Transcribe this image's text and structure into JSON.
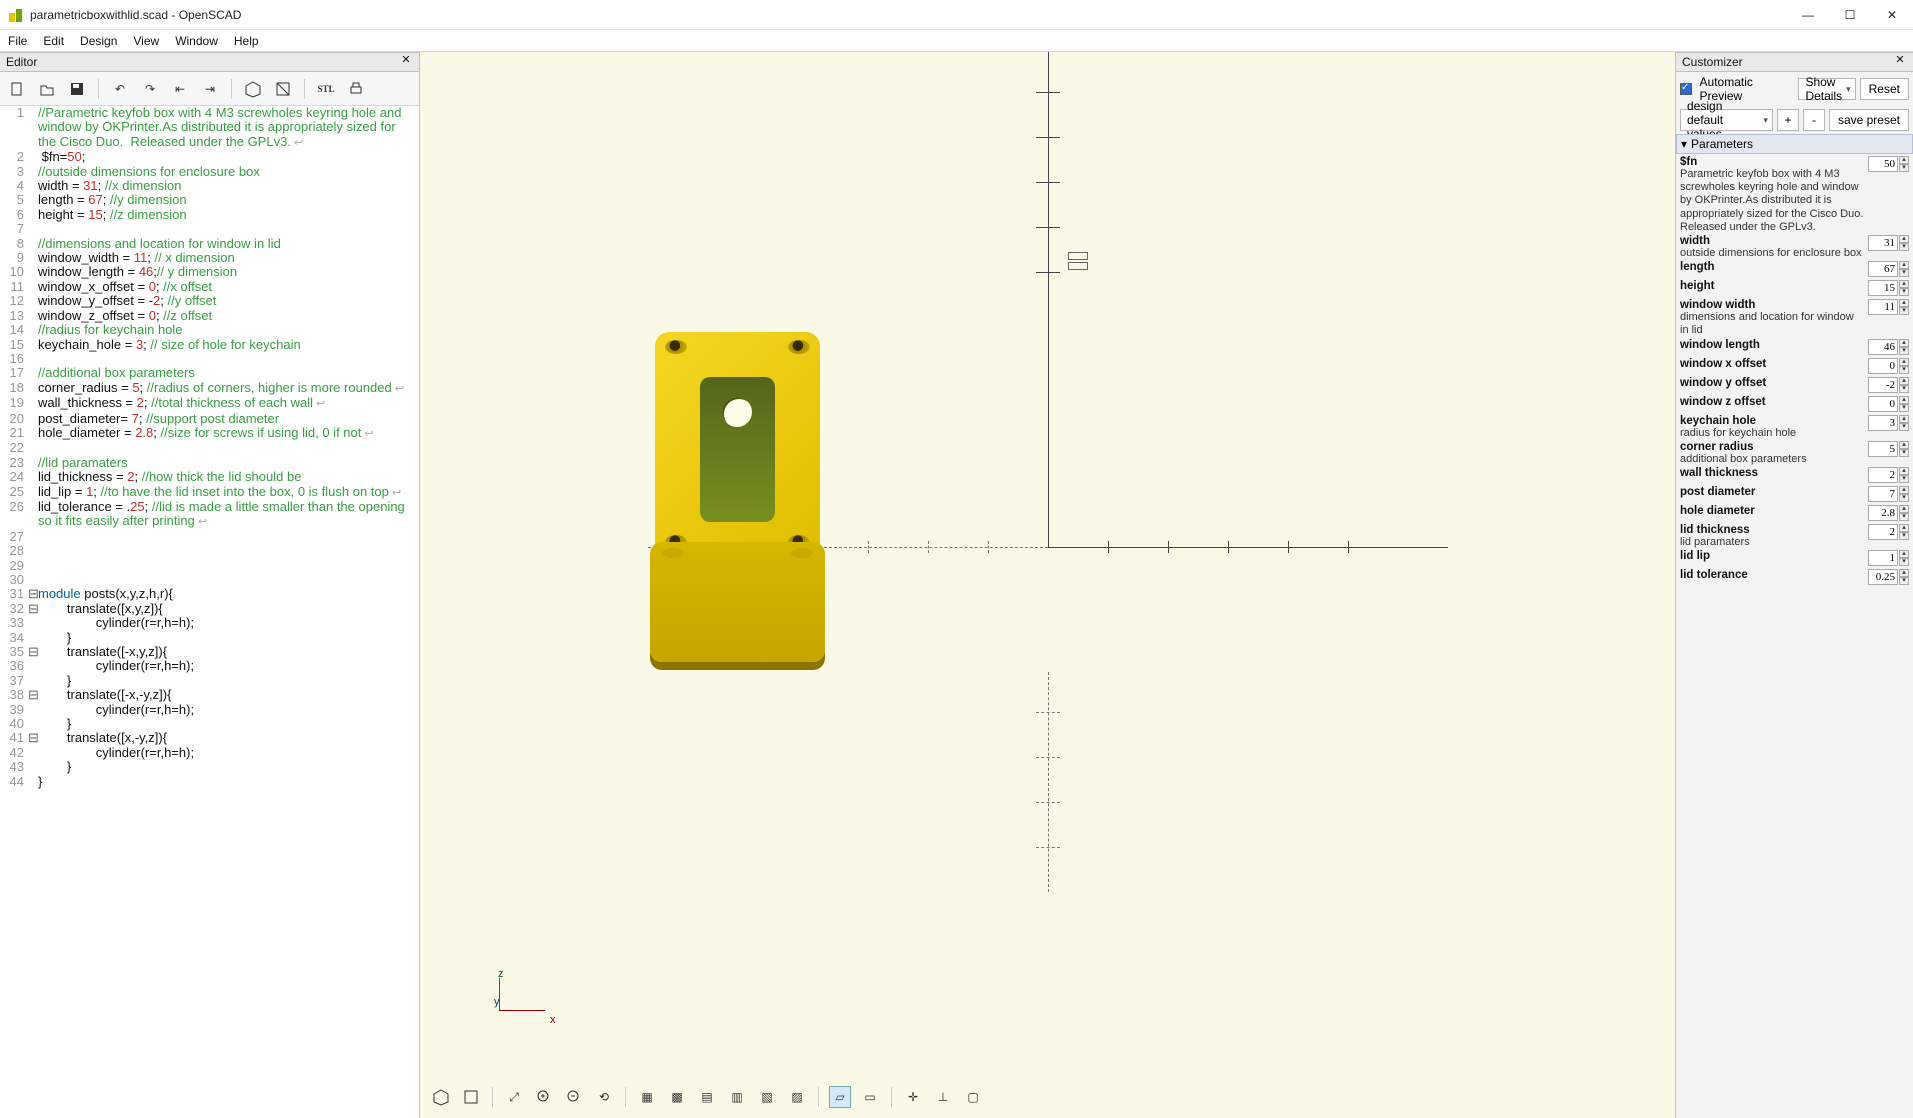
{
  "window": {
    "title": "parametricboxwithlid.scad - OpenSCAD"
  },
  "menu": [
    "File",
    "Edit",
    "Design",
    "View",
    "Window",
    "Help"
  ],
  "editor": {
    "title": "Editor",
    "lines": [
      {
        "n": 1,
        "fold": "",
        "wrap": true,
        "segs": [
          {
            "t": "//Parametric keyfob box with 4 M3 screwholes keyring hole and window by OKPrinter.As distributed it is appropriately sized for the Cisco Duo.  Released under the GPLv3.",
            "c": "c-comment"
          }
        ]
      },
      {
        "n": 2,
        "fold": "",
        "segs": [
          {
            "t": " $fn=",
            "c": ""
          },
          {
            "t": "50",
            "c": "c-num"
          },
          {
            "t": ";",
            "c": ""
          }
        ]
      },
      {
        "n": 3,
        "fold": "",
        "segs": [
          {
            "t": "//outside dimensions for enclosure box",
            "c": "c-comment"
          }
        ]
      },
      {
        "n": 4,
        "fold": "",
        "segs": [
          {
            "t": "width = ",
            "c": ""
          },
          {
            "t": "31",
            "c": "c-num"
          },
          {
            "t": "; ",
            "c": ""
          },
          {
            "t": "//x dimension",
            "c": "c-comment"
          }
        ]
      },
      {
        "n": 5,
        "fold": "",
        "segs": [
          {
            "t": "length = ",
            "c": ""
          },
          {
            "t": "67",
            "c": "c-num"
          },
          {
            "t": "; ",
            "c": ""
          },
          {
            "t": "//y dimension",
            "c": "c-comment"
          }
        ]
      },
      {
        "n": 6,
        "fold": "",
        "segs": [
          {
            "t": "height = ",
            "c": ""
          },
          {
            "t": "15",
            "c": "c-num"
          },
          {
            "t": "; ",
            "c": ""
          },
          {
            "t": "//z dimension",
            "c": "c-comment"
          }
        ]
      },
      {
        "n": 7,
        "fold": "",
        "segs": [
          {
            "t": "",
            "c": ""
          }
        ]
      },
      {
        "n": 8,
        "fold": "",
        "segs": [
          {
            "t": "//dimensions and location for window in lid",
            "c": "c-comment"
          }
        ]
      },
      {
        "n": 9,
        "fold": "",
        "segs": [
          {
            "t": "window_width = ",
            "c": ""
          },
          {
            "t": "11",
            "c": "c-num"
          },
          {
            "t": "; ",
            "c": ""
          },
          {
            "t": "// x dimension",
            "c": "c-comment"
          }
        ]
      },
      {
        "n": 10,
        "fold": "",
        "segs": [
          {
            "t": "window_length = ",
            "c": ""
          },
          {
            "t": "46",
            "c": "c-num"
          },
          {
            "t": ";",
            "c": ""
          },
          {
            "t": "// y dimension",
            "c": "c-comment"
          }
        ]
      },
      {
        "n": 11,
        "fold": "",
        "segs": [
          {
            "t": "window_x_offset = ",
            "c": ""
          },
          {
            "t": "0",
            "c": "c-num"
          },
          {
            "t": "; ",
            "c": ""
          },
          {
            "t": "//x offset",
            "c": "c-comment"
          }
        ]
      },
      {
        "n": 12,
        "fold": "",
        "segs": [
          {
            "t": "window_y_offset = -",
            "c": ""
          },
          {
            "t": "2",
            "c": "c-num"
          },
          {
            "t": "; ",
            "c": ""
          },
          {
            "t": "//y offset",
            "c": "c-comment"
          }
        ]
      },
      {
        "n": 13,
        "fold": "",
        "segs": [
          {
            "t": "window_z_offset = ",
            "c": ""
          },
          {
            "t": "0",
            "c": "c-num"
          },
          {
            "t": "; ",
            "c": ""
          },
          {
            "t": "//z offset",
            "c": "c-comment"
          }
        ]
      },
      {
        "n": 14,
        "fold": "",
        "segs": [
          {
            "t": "//radius for keychain hole",
            "c": "c-comment"
          }
        ]
      },
      {
        "n": 15,
        "fold": "",
        "segs": [
          {
            "t": "keychain_hole = ",
            "c": ""
          },
          {
            "t": "3",
            "c": "c-num"
          },
          {
            "t": "; ",
            "c": ""
          },
          {
            "t": "// size of hole for keychain",
            "c": "c-comment"
          }
        ]
      },
      {
        "n": 16,
        "fold": "",
        "segs": [
          {
            "t": "",
            "c": ""
          }
        ]
      },
      {
        "n": 17,
        "fold": "",
        "segs": [
          {
            "t": "//additional box parameters",
            "c": "c-comment"
          }
        ]
      },
      {
        "n": 18,
        "fold": "",
        "wrap": true,
        "segs": [
          {
            "t": "corner_radius = ",
            "c": ""
          },
          {
            "t": "5",
            "c": "c-num"
          },
          {
            "t": "; ",
            "c": ""
          },
          {
            "t": "//radius of corners, higher is more rounded",
            "c": "c-comment"
          }
        ]
      },
      {
        "n": 19,
        "fold": "",
        "wrap": true,
        "segs": [
          {
            "t": "wall_thickness = ",
            "c": ""
          },
          {
            "t": "2",
            "c": "c-num"
          },
          {
            "t": "; ",
            "c": ""
          },
          {
            "t": "//total thickness of each wall",
            "c": "c-comment"
          }
        ]
      },
      {
        "n": 20,
        "fold": "",
        "segs": [
          {
            "t": "post_diameter= ",
            "c": ""
          },
          {
            "t": "7",
            "c": "c-num"
          },
          {
            "t": "; ",
            "c": ""
          },
          {
            "t": "//support post diameter",
            "c": "c-comment"
          }
        ]
      },
      {
        "n": 21,
        "fold": "",
        "wrap": true,
        "segs": [
          {
            "t": "hole_diameter = ",
            "c": ""
          },
          {
            "t": "2.8",
            "c": "c-num"
          },
          {
            "t": "; ",
            "c": ""
          },
          {
            "t": "//size for screws if using lid, 0 if not",
            "c": "c-comment"
          }
        ]
      },
      {
        "n": 22,
        "fold": "",
        "segs": [
          {
            "t": "",
            "c": ""
          }
        ]
      },
      {
        "n": 23,
        "fold": "",
        "segs": [
          {
            "t": "//lid paramaters",
            "c": "c-comment"
          }
        ]
      },
      {
        "n": 24,
        "fold": "",
        "segs": [
          {
            "t": "lid_thickness = ",
            "c": ""
          },
          {
            "t": "2",
            "c": "c-num"
          },
          {
            "t": "; ",
            "c": ""
          },
          {
            "t": "//how thick the lid should be",
            "c": "c-comment"
          }
        ]
      },
      {
        "n": 25,
        "fold": "",
        "wrap": true,
        "segs": [
          {
            "t": "lid_lip = ",
            "c": ""
          },
          {
            "t": "1",
            "c": "c-num"
          },
          {
            "t": "; ",
            "c": ""
          },
          {
            "t": "//to have the lid inset into the box, 0 is flush on top",
            "c": "c-comment"
          }
        ]
      },
      {
        "n": 26,
        "fold": "",
        "wrap": true,
        "segs": [
          {
            "t": "lid_tolerance = .",
            "c": ""
          },
          {
            "t": "25",
            "c": "c-num"
          },
          {
            "t": "; ",
            "c": ""
          },
          {
            "t": "//lid is made a little smaller than the opening so it fits easily after printing",
            "c": "c-comment"
          }
        ]
      },
      {
        "n": 27,
        "fold": "",
        "segs": [
          {
            "t": "",
            "c": ""
          }
        ]
      },
      {
        "n": 28,
        "fold": "",
        "segs": [
          {
            "t": "",
            "c": ""
          }
        ]
      },
      {
        "n": 29,
        "fold": "",
        "segs": [
          {
            "t": "",
            "c": ""
          }
        ]
      },
      {
        "n": 30,
        "fold": "",
        "segs": [
          {
            "t": "",
            "c": ""
          }
        ]
      },
      {
        "n": 31,
        "fold": "⊟",
        "segs": [
          {
            "t": "module",
            "c": "c-kw"
          },
          {
            "t": " posts(x,y,z,h,r){",
            "c": ""
          }
        ]
      },
      {
        "n": 32,
        "fold": "⊟",
        "segs": [
          {
            "t": "        translate([x,y,z]){",
            "c": ""
          }
        ]
      },
      {
        "n": 33,
        "fold": "",
        "segs": [
          {
            "t": "                cylinder(r=r,h=h);",
            "c": ""
          }
        ]
      },
      {
        "n": 34,
        "fold": "",
        "segs": [
          {
            "t": "        }",
            "c": ""
          }
        ]
      },
      {
        "n": 35,
        "fold": "⊟",
        "segs": [
          {
            "t": "        translate([-x,y,z]){",
            "c": ""
          }
        ]
      },
      {
        "n": 36,
        "fold": "",
        "segs": [
          {
            "t": "                cylinder(r=r,h=h);",
            "c": ""
          }
        ]
      },
      {
        "n": 37,
        "fold": "",
        "segs": [
          {
            "t": "        }",
            "c": ""
          }
        ]
      },
      {
        "n": 38,
        "fold": "⊟",
        "segs": [
          {
            "t": "        translate([-x,-y,z]){",
            "c": ""
          }
        ]
      },
      {
        "n": 39,
        "fold": "",
        "segs": [
          {
            "t": "                cylinder(r=r,h=h);",
            "c": ""
          }
        ]
      },
      {
        "n": 40,
        "fold": "",
        "segs": [
          {
            "t": "        }",
            "c": ""
          }
        ]
      },
      {
        "n": 41,
        "fold": "⊟",
        "segs": [
          {
            "t": "        translate([x,-y,z]){",
            "c": ""
          }
        ]
      },
      {
        "n": 42,
        "fold": "",
        "segs": [
          {
            "t": "                cylinder(r=r,h=h);",
            "c": ""
          }
        ]
      },
      {
        "n": 43,
        "fold": "",
        "segs": [
          {
            "t": "        }",
            "c": ""
          }
        ]
      },
      {
        "n": 44,
        "fold": "",
        "segs": [
          {
            "t": "}",
            "c": ""
          }
        ]
      }
    ]
  },
  "customizer": {
    "title": "Customizer",
    "auto_preview": "Automatic Preview",
    "details_label": "Show Details",
    "reset": "Reset",
    "preset_select": "design default values",
    "plus": "+",
    "minus": "-",
    "save": "save preset",
    "section": "Parameters",
    "params": [
      {
        "name": "$fn",
        "desc": "Parametric keyfob box with 4 M3 screwholes keyring hole and window by OKPrinter.As distributed it is appropriately sized for the Cisco Duo.  Released under the GPLv3.",
        "value": "50"
      },
      {
        "name": "width",
        "desc": "outside dimensions for enclosure box",
        "value": "31"
      },
      {
        "name": "length",
        "value": "67"
      },
      {
        "name": "height",
        "value": "15"
      },
      {
        "name": "window width",
        "desc": "dimensions and location for window in lid",
        "value": "11"
      },
      {
        "name": "window length",
        "value": "46"
      },
      {
        "name": "window x offset",
        "value": "0"
      },
      {
        "name": "window y offset",
        "value": "-2"
      },
      {
        "name": "window z offset",
        "value": "0"
      },
      {
        "name": "keychain hole",
        "desc": "radius for keychain hole",
        "value": "3"
      },
      {
        "name": "corner radius",
        "desc": "additional box parameters",
        "value": "5"
      },
      {
        "name": "wall thickness",
        "value": "2"
      },
      {
        "name": "post diameter",
        "value": "7"
      },
      {
        "name": "hole diameter",
        "value": "2.8"
      },
      {
        "name": "lid thickness",
        "desc": "lid paramaters",
        "value": "2"
      },
      {
        "name": "lid lip",
        "value": "1"
      },
      {
        "name": "lid tolerance",
        "value": "0.25"
      }
    ]
  },
  "orient": {
    "z": "z",
    "y": "y",
    "x": "x"
  }
}
